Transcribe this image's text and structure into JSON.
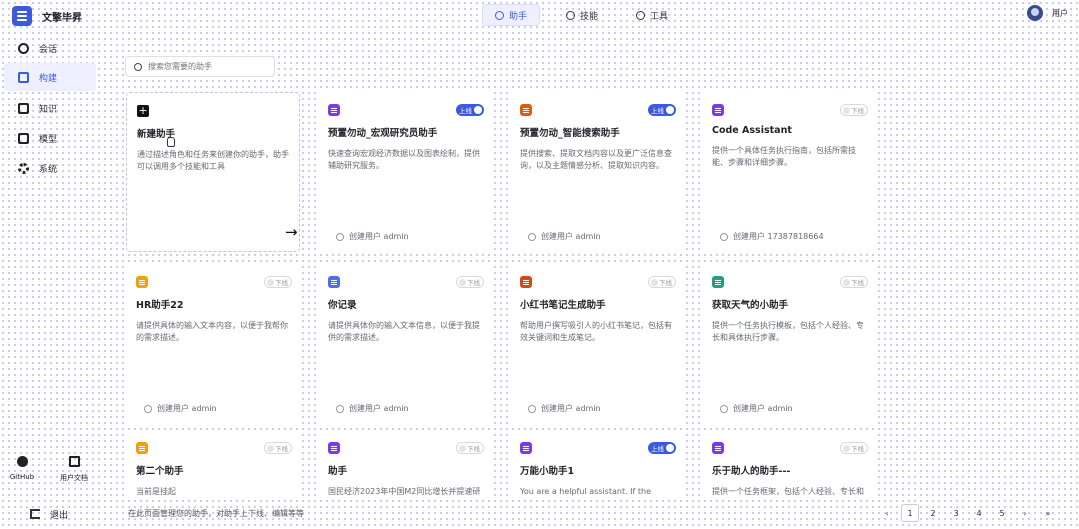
{
  "app": {
    "title": "文擎毕昇"
  },
  "top_tabs": [
    {
      "label": "助手",
      "icon": "assistant-icon",
      "active": true
    },
    {
      "label": "技能",
      "icon": "skill-icon",
      "active": false
    },
    {
      "label": "工具",
      "icon": "tool-icon",
      "active": false
    }
  ],
  "user": {
    "name": "用户"
  },
  "sidebar": {
    "items": [
      {
        "label": "会话",
        "icon": "chat-icon",
        "active": false
      },
      {
        "label": "构建",
        "icon": "build-icon",
        "active": true
      },
      {
        "label": "知识",
        "icon": "knowledge-icon",
        "active": false
      },
      {
        "label": "模型",
        "icon": "model-icon",
        "active": false
      },
      {
        "label": "系统",
        "icon": "gear-icon",
        "active": false
      }
    ],
    "github_label": "GitHub",
    "docs_label": "用户文档",
    "logout_label": "退出"
  },
  "search": {
    "placeholder": "搜索您需要的助手",
    "value": ""
  },
  "new_card": {
    "title": "新建助手",
    "desc": "通过描述角色和任务来创建你的助手，助手可以调用多个技能和工具"
  },
  "cards": [
    {
      "title": "预置勿动_宏观研究员助手",
      "desc": "快速查询宏观经济数据以及图表绘制，提供辅助研究服务。",
      "creator": "创建用户 admin",
      "status": "上线",
      "online": true,
      "color": "#7c3aed"
    },
    {
      "title": "预置勿动_智能搜索助手",
      "desc": "提供搜索、提取文档内容以及更广泛信息查询，以及主题情感分析、提取知识内容。",
      "creator": "创建用户 admin",
      "status": "上线",
      "online": true,
      "color": "#e8590c"
    },
    {
      "title": "Code Assistant",
      "desc": "提供一个具体任务执行指南，包括所需技能、步骤和详细步骤。",
      "creator": "创建用户 17387818664",
      "status": "下线",
      "online": false,
      "color": "#7c3aed"
    },
    {
      "title": "HR助手22",
      "desc": "请提供具体的输入文本内容，以便于我帮你的需求描述。",
      "creator": "创建用户 admin",
      "status": "下线",
      "online": false,
      "color": "#f59f00"
    },
    {
      "title": "你记录",
      "desc": "请提供具体你的输入文本信息，以便于我提供的需求描述。",
      "creator": "创建用户 admin",
      "status": "下线",
      "online": false,
      "color": "#4c6ef5"
    },
    {
      "title": "小红书笔记生成助手",
      "desc": "帮助用户撰写吸引人的小红书笔记，包括有效关键词和生成笔记。",
      "creator": "创建用户 admin",
      "status": "下线",
      "online": false,
      "color": "#d9480f"
    },
    {
      "title": "获取天气的小助手",
      "desc": "提供一个任务执行模板，包括个人经验、专长和具体执行步骤。",
      "creator": "创建用户 admin",
      "status": "下线",
      "online": false,
      "color": "#20a080"
    },
    {
      "title": "第二个助手",
      "desc": "当前是挂起",
      "creator": "",
      "status": "下线",
      "online": false,
      "color": "#f59f00"
    },
    {
      "title": "助手",
      "desc": "国民经济2023年中国M2同比增长并提速研",
      "creator": "",
      "status": "下线",
      "online": false,
      "color": "#7c3aed"
    },
    {
      "title": "万能小助手1",
      "desc": "You are a helpful assistant. If the user's qu",
      "creator": "",
      "status": "上线",
      "online": true,
      "color": "#7c3aed"
    },
    {
      "title": "乐于助人的助手---",
      "desc": "提供一个任务框架，包括个人经验、专长和",
      "creator": "",
      "status": "下线",
      "online": false,
      "color": "#7c3aed"
    }
  ],
  "footer": {
    "hint": "在此页面管理您的助手，对助手上下线、编辑等等",
    "pages": [
      "1",
      "2",
      "3",
      "4",
      "5"
    ],
    "current_page": "1",
    "prev": "‹",
    "next": "›",
    "last": "»"
  }
}
